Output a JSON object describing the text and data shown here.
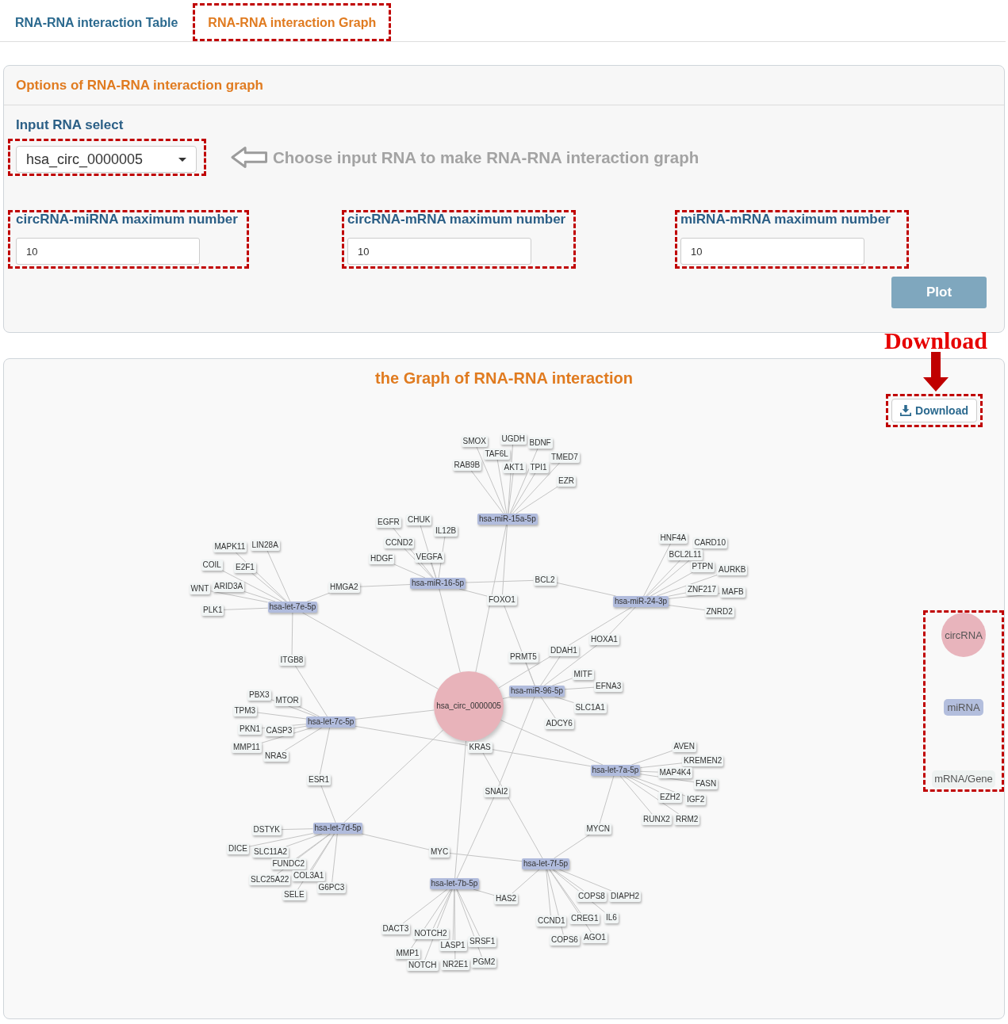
{
  "tabs": [
    {
      "label": "RNA-RNA interaction Table",
      "selected": false,
      "highlighted": false
    },
    {
      "label": "RNA-RNA interaction Graph",
      "selected": true,
      "highlighted": true
    }
  ],
  "options_panel": {
    "title": "Options of RNA-RNA interaction graph",
    "input_select": {
      "label": "Input RNA select",
      "value": "hsa_circ_0000005",
      "highlighted": true
    },
    "hint": "Choose input RNA to make RNA-RNA interaction graph",
    "number_inputs": [
      {
        "label": "circRNA-miRNA maximum number",
        "value": "10",
        "highlighted": true
      },
      {
        "label": "circRNA-mRNA maximum number",
        "value": "10",
        "highlighted": true
      },
      {
        "label": "miRNA-mRNA maximum number",
        "value": "10",
        "highlighted": true
      }
    ],
    "plot_button": "Plot"
  },
  "download_annotation": "Download",
  "graph_panel": {
    "title": "the Graph of RNA-RNA interaction",
    "download_button": {
      "label": "Download",
      "highlighted": true
    },
    "nodes": [
      {
        "label": "SMOX",
        "kind": "mRNA"
      },
      {
        "label": "UGDH",
        "kind": "mRNA"
      },
      {
        "label": "BDNF",
        "kind": "mRNA"
      },
      {
        "label": "TAF6L",
        "kind": "mRNA"
      },
      {
        "label": "TMED7",
        "kind": "mRNA"
      },
      {
        "label": "RAB9B",
        "kind": "mRNA"
      },
      {
        "label": "AKT1",
        "kind": "mRNA"
      },
      {
        "label": "TPI1",
        "kind": "mRNA"
      },
      {
        "label": "EZR",
        "kind": "mRNA"
      },
      {
        "label": "EGFR",
        "kind": "mRNA"
      },
      {
        "label": "CHUK",
        "kind": "mRNA"
      },
      {
        "label": "hsa-miR-15a-5p",
        "kind": "miRNA"
      },
      {
        "label": "IL12B",
        "kind": "mRNA"
      },
      {
        "label": "HNF4A",
        "kind": "mRNA"
      },
      {
        "label": "MAPK11",
        "kind": "mRNA"
      },
      {
        "label": "LIN28A",
        "kind": "mRNA"
      },
      {
        "label": "CCND2",
        "kind": "mRNA"
      },
      {
        "label": "CARD10",
        "kind": "mRNA"
      },
      {
        "label": "HDGF",
        "kind": "mRNA"
      },
      {
        "label": "VEGFA",
        "kind": "mRNA"
      },
      {
        "label": "BCL2L11",
        "kind": "mRNA"
      },
      {
        "label": "COIL",
        "kind": "mRNA"
      },
      {
        "label": "E2F1",
        "kind": "mRNA"
      },
      {
        "label": "PTPN",
        "kind": "mRNA"
      },
      {
        "label": "AURKB",
        "kind": "mRNA"
      },
      {
        "label": "WNT",
        "kind": "mRNA"
      },
      {
        "label": "ARID3A",
        "kind": "mRNA"
      },
      {
        "label": "HMGA2",
        "kind": "mRNA"
      },
      {
        "label": "hsa-miR-16-5p",
        "kind": "miRNA"
      },
      {
        "label": "BCL2",
        "kind": "mRNA"
      },
      {
        "label": "ZNF217",
        "kind": "mRNA"
      },
      {
        "label": "MAFB",
        "kind": "mRNA"
      },
      {
        "label": "FOXO1",
        "kind": "mRNA"
      },
      {
        "label": "hsa-miR-24-3p",
        "kind": "miRNA"
      },
      {
        "label": "PLK1",
        "kind": "mRNA"
      },
      {
        "label": "hsa-let-7e-5p",
        "kind": "miRNA"
      },
      {
        "label": "ZNRD2",
        "kind": "mRNA"
      },
      {
        "label": "HOXA1",
        "kind": "mRNA"
      },
      {
        "label": "DDAH1",
        "kind": "mRNA"
      },
      {
        "label": "ITGB8",
        "kind": "mRNA"
      },
      {
        "label": "PRMT5",
        "kind": "mRNA"
      },
      {
        "label": "MITF",
        "kind": "mRNA"
      },
      {
        "label": "EFNA3",
        "kind": "mRNA"
      },
      {
        "label": "PBX3",
        "kind": "mRNA"
      },
      {
        "label": "hsa-miR-96-5p",
        "kind": "miRNA"
      },
      {
        "label": "MTOR",
        "kind": "mRNA"
      },
      {
        "label": "TPM3",
        "kind": "mRNA"
      },
      {
        "label": "hsa_circ_0000005",
        "kind": "circRNA"
      },
      {
        "label": "SLC1A1",
        "kind": "mRNA"
      },
      {
        "label": "hsa-let-7c-5p",
        "kind": "miRNA"
      },
      {
        "label": "ADCY6",
        "kind": "mRNA"
      },
      {
        "label": "PKN1",
        "kind": "mRNA"
      },
      {
        "label": "CASP3",
        "kind": "mRNA"
      },
      {
        "label": "MMP11",
        "kind": "mRNA"
      },
      {
        "label": "KRAS",
        "kind": "mRNA"
      },
      {
        "label": "AVEN",
        "kind": "mRNA"
      },
      {
        "label": "NRAS",
        "kind": "mRNA"
      },
      {
        "label": "KREMEN2",
        "kind": "mRNA"
      },
      {
        "label": "hsa-let-7a-5p",
        "kind": "miRNA"
      },
      {
        "label": "MAP4K4",
        "kind": "mRNA"
      },
      {
        "label": "ESR1",
        "kind": "mRNA"
      },
      {
        "label": "FASN",
        "kind": "mRNA"
      },
      {
        "label": "SNAI2",
        "kind": "mRNA"
      },
      {
        "label": "EZH2",
        "kind": "mRNA"
      },
      {
        "label": "IGF2",
        "kind": "mRNA"
      },
      {
        "label": "RUNX2",
        "kind": "mRNA"
      },
      {
        "label": "RRM2",
        "kind": "mRNA"
      },
      {
        "label": "DSTYK",
        "kind": "mRNA"
      },
      {
        "label": "hsa-let-7d-5p",
        "kind": "miRNA"
      },
      {
        "label": "MYCN",
        "kind": "mRNA"
      },
      {
        "label": "DICE",
        "kind": "mRNA"
      },
      {
        "label": "SLC11A2",
        "kind": "mRNA"
      },
      {
        "label": "MYC",
        "kind": "mRNA"
      },
      {
        "label": "FUNDC2",
        "kind": "mRNA"
      },
      {
        "label": "hsa-let-7f-5p",
        "kind": "miRNA"
      },
      {
        "label": "SLC25A22",
        "kind": "mRNA"
      },
      {
        "label": "COL3A1",
        "kind": "mRNA"
      },
      {
        "label": "G6PC3",
        "kind": "mRNA"
      },
      {
        "label": "hsa-let-7b-5p",
        "kind": "miRNA"
      },
      {
        "label": "SELE",
        "kind": "mRNA"
      },
      {
        "label": "HAS2",
        "kind": "mRNA"
      },
      {
        "label": "COPS8",
        "kind": "mRNA"
      },
      {
        "label": "DIAPH2",
        "kind": "mRNA"
      },
      {
        "label": "CCND1",
        "kind": "mRNA"
      },
      {
        "label": "CREG1",
        "kind": "mRNA"
      },
      {
        "label": "IL6",
        "kind": "mRNA"
      },
      {
        "label": "DACT3",
        "kind": "mRNA"
      },
      {
        "label": "NOTCH2",
        "kind": "mRNA"
      },
      {
        "label": "LASP1",
        "kind": "mRNA"
      },
      {
        "label": "SRSF1",
        "kind": "mRNA"
      },
      {
        "label": "COPS6",
        "kind": "mRNA"
      },
      {
        "label": "AGO1",
        "kind": "mRNA"
      },
      {
        "label": "MMP1",
        "kind": "mRNA"
      },
      {
        "label": "NOTCH",
        "kind": "mRNA"
      },
      {
        "label": "NR2E1",
        "kind": "mRNA"
      },
      {
        "label": "PGM2",
        "kind": "mRNA"
      }
    ],
    "legend": {
      "highlighted": true,
      "items": [
        {
          "label": "circRNA",
          "kind": "circRNA"
        },
        {
          "label": "miRNA",
          "kind": "miRNA"
        },
        {
          "label": "mRNA/Gene",
          "kind": "mRNA"
        }
      ]
    }
  }
}
